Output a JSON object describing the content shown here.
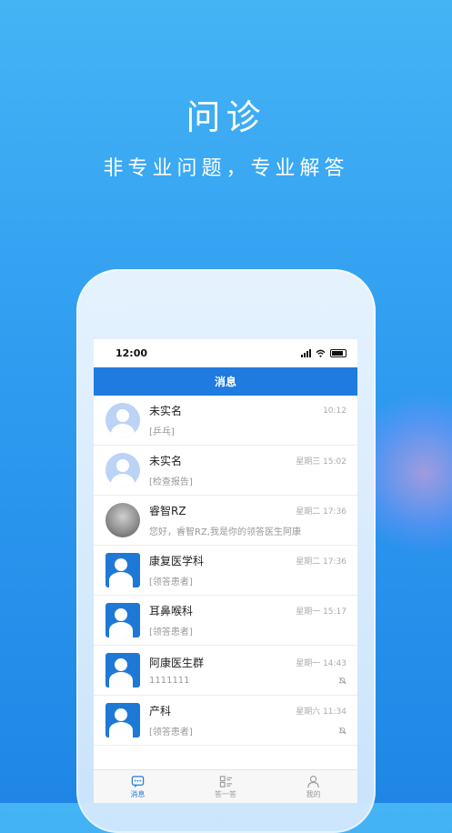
{
  "hero": {
    "title": "问诊",
    "subtitle": "非专业问题，专业解答"
  },
  "status_bar": {
    "time": "12:00"
  },
  "nav": {
    "title": "消息"
  },
  "conversations": [
    {
      "name": "未实名",
      "preview": "[乒乓]",
      "time": "10:12",
      "avatar": "default-avatar-icon",
      "muted": false
    },
    {
      "name": "未实名",
      "preview": "[检查报告]",
      "time": "星期三 15:02",
      "avatar": "default-avatar-icon",
      "muted": false
    },
    {
      "name": "睿智RZ",
      "preview": "您好，睿智RZ,我是你的领答医生阿康",
      "time": "星期二 17:36",
      "avatar": "photo-avatar",
      "muted": false
    },
    {
      "name": "康复医学科",
      "preview": "[领答患者]",
      "time": "星期二 17:36",
      "avatar": "group-avatar-icon",
      "muted": false
    },
    {
      "name": "耳鼻喉科",
      "preview": "[领答患者]",
      "time": "星期一 15:17",
      "avatar": "group-avatar-icon",
      "muted": false
    },
    {
      "name": "阿康医生群",
      "preview": "1111111",
      "time": "星期一 14:43",
      "avatar": "group-avatar-icon",
      "muted": true
    },
    {
      "name": "产科",
      "preview": "[领答患者]",
      "time": "星期六 11:34",
      "avatar": "group-avatar-icon",
      "muted": true
    }
  ],
  "tabs": [
    {
      "label": "消息",
      "icon": "chat-icon",
      "active": true
    },
    {
      "label": "答一答",
      "icon": "list-icon",
      "active": false
    },
    {
      "label": "我的",
      "icon": "user-icon",
      "active": false
    }
  ],
  "colors": {
    "accent": "#1f7bdf",
    "background_top": "#45b4f5",
    "background_bottom": "#1f86e6"
  }
}
